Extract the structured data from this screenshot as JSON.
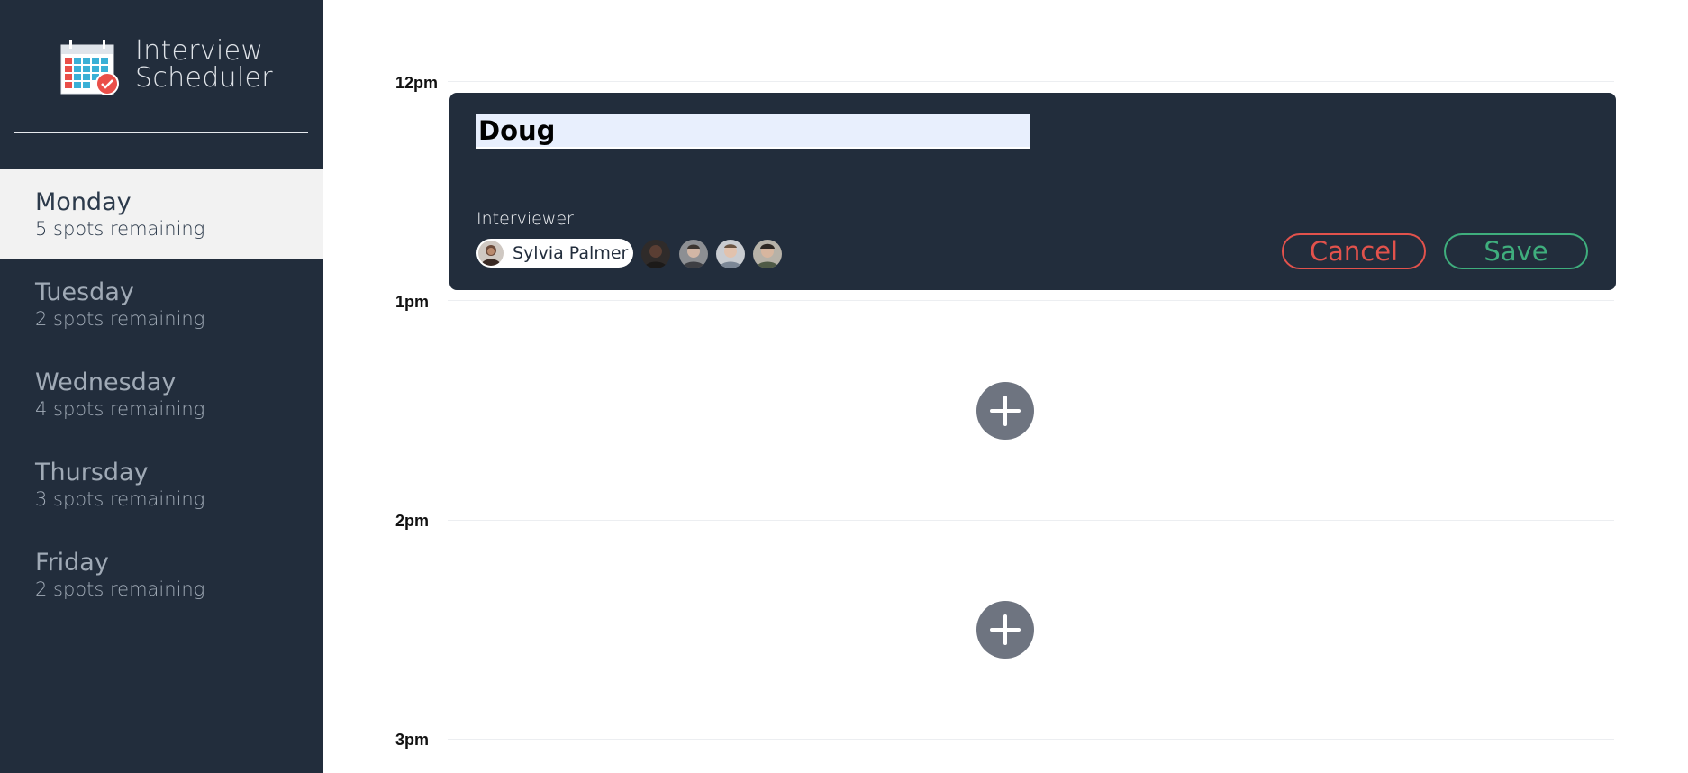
{
  "app": {
    "title_line1": "Interview",
    "title_line2": "Scheduler",
    "logo_icon": "calendar-check-icon"
  },
  "sidebar": {
    "days": [
      {
        "name": "Monday",
        "spots": "5 spots remaining",
        "selected": true
      },
      {
        "name": "Tuesday",
        "spots": "2 spots remaining",
        "selected": false
      },
      {
        "name": "Wednesday",
        "spots": "4 spots remaining",
        "selected": false
      },
      {
        "name": "Thursday",
        "spots": "3 spots remaining",
        "selected": false
      },
      {
        "name": "Friday",
        "spots": "2 spots remaining",
        "selected": false
      }
    ]
  },
  "schedule": {
    "times": [
      "12pm",
      "1pm",
      "2pm",
      "3pm"
    ]
  },
  "form": {
    "student_name": "Doug",
    "interviewer_label": "Interviewer",
    "selected_interviewer": "Sylvia Palmer",
    "cancel_label": "Cancel",
    "save_label": "Save"
  },
  "colors": {
    "sidebar_bg": "#222d3c",
    "cancel": "#e2524c",
    "save": "#3fae7d",
    "add_button": "#6e7480"
  }
}
